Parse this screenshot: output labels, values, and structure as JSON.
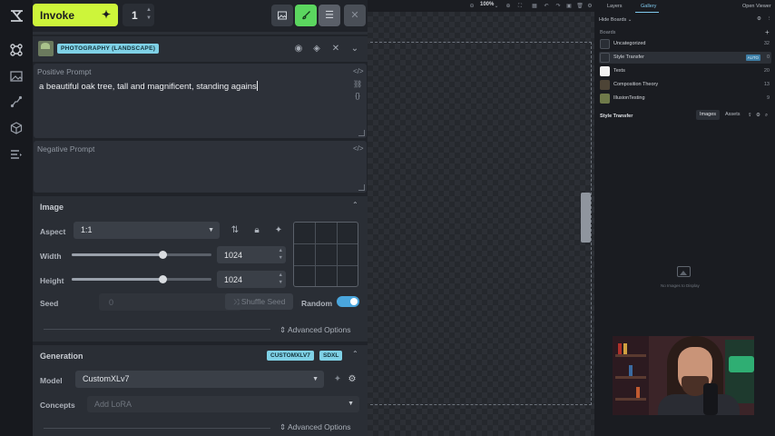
{
  "toolbar": {
    "invoke_label": "Invoke",
    "invoke_icon": "sparkle-icon",
    "iterations": "1"
  },
  "style": {
    "badge": "PHOTOGRAPHY (LANDSCAPE)"
  },
  "prompts": {
    "positive_label": "Positive Prompt",
    "positive_text": "a beautiful oak tree, tall and magnificent, standing agains",
    "negative_label": "Negative Prompt",
    "negative_text": ""
  },
  "image": {
    "title": "Image",
    "aspect_label": "Aspect",
    "aspect_value": "1:1",
    "width_label": "Width",
    "width_value": "1024",
    "width_fraction": 0.67,
    "height_label": "Height",
    "height_value": "1024",
    "height_fraction": 0.67,
    "seed_label": "Seed",
    "seed_value": "0",
    "shuffle_label": "Shuffle Seed",
    "random_label": "Random",
    "random_on": true,
    "advanced_label": "Advanced Options"
  },
  "generation": {
    "title": "Generation",
    "badges": [
      "CUSTOMXLV7",
      "SDXL"
    ],
    "model_label": "Model",
    "model_value": "CustomXLv7",
    "concepts_label": "Concepts",
    "concepts_placeholder": "Add LoRA",
    "advanced_label": "Advanced Options"
  },
  "canvas": {
    "zoom": "100%"
  },
  "right": {
    "tabs": [
      "Layers",
      "Gallery"
    ],
    "open_viewer": "Open Viewer",
    "hide_boards": "Hide Boards",
    "boards_heading": "Boards",
    "boards": [
      {
        "name": "Uncategorized",
        "count": "32"
      },
      {
        "name": "Style Transfer",
        "count": "0",
        "auto": "AUTO"
      },
      {
        "name": "Texts",
        "count": "20"
      },
      {
        "name": "Composition Theory",
        "count": "13"
      },
      {
        "name": "IllusionTesting",
        "count": "9"
      }
    ],
    "selected_board": "Style Transfer",
    "gallery_tabs": [
      "Images",
      "Assets"
    ],
    "empty_text": "No Images to Display"
  },
  "colors": {
    "accent": "#cdf53a",
    "badge": "#7fd1e6",
    "toggle": "#4aa6dd",
    "tab_active": "#7fc8ec"
  }
}
